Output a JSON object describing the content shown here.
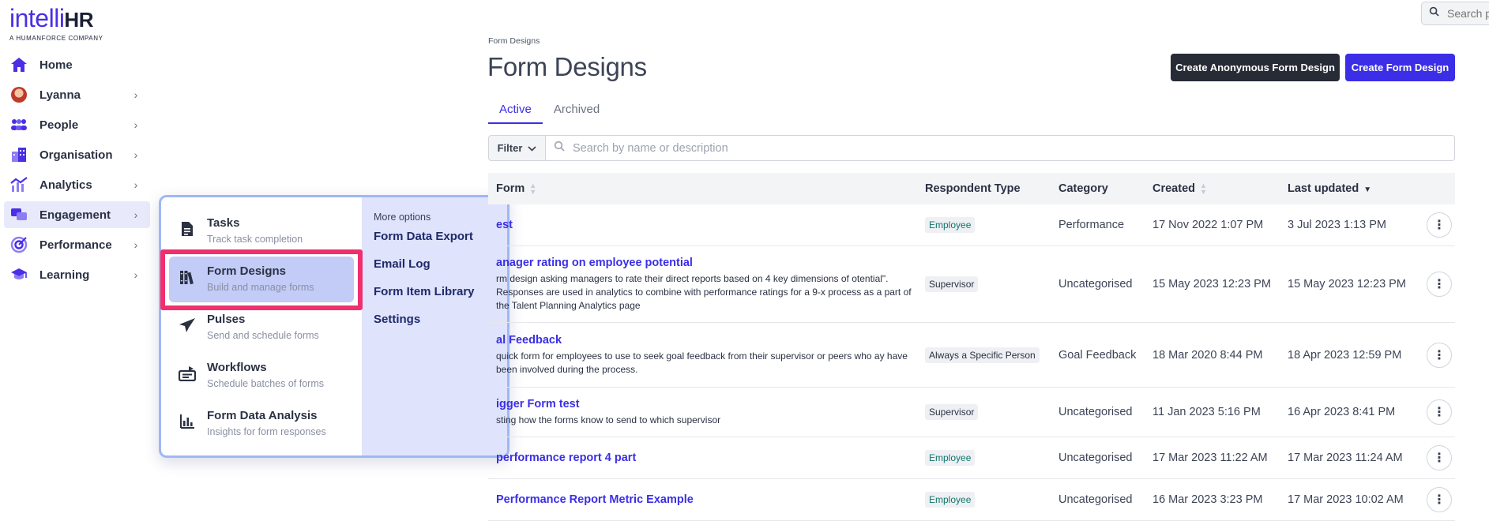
{
  "brand": {
    "name_light": "intelli",
    "name_bold": "HR",
    "tagline": "A HUMANFORCE COMPANY"
  },
  "top_search": {
    "placeholder": "Search pe"
  },
  "sidebar": {
    "items": [
      {
        "label": "Home",
        "icon": "home-icon"
      },
      {
        "label": "Lyanna",
        "icon": "avatar"
      },
      {
        "label": "People",
        "icon": "people-icon"
      },
      {
        "label": "Organisation",
        "icon": "organisation-icon"
      },
      {
        "label": "Analytics",
        "icon": "analytics-icon"
      },
      {
        "label": "Engagement",
        "icon": "engagement-icon",
        "active": true
      },
      {
        "label": "Performance",
        "icon": "performance-icon"
      },
      {
        "label": "Learning",
        "icon": "learning-icon"
      }
    ]
  },
  "flyout": {
    "items": [
      {
        "title": "Tasks",
        "subtitle": "Track task completion",
        "icon": "task-document-icon"
      },
      {
        "title": "Form Designs",
        "subtitle": "Build and manage forms",
        "icon": "form-library-icon",
        "selected": true
      },
      {
        "title": "Pulses",
        "subtitle": "Send and schedule forms",
        "icon": "paper-plane-icon"
      },
      {
        "title": "Workflows",
        "subtitle": "Schedule batches of forms",
        "icon": "workflow-icon"
      },
      {
        "title": "Form Data Analysis",
        "subtitle": "Insights for form responses",
        "icon": "bar-chart-icon"
      }
    ],
    "more_options": {
      "heading": "More options",
      "links": [
        "Form Data Export",
        "Email Log",
        "Form Item Library",
        "Settings"
      ]
    }
  },
  "main": {
    "breadcrumb": "Form Designs",
    "title": "Form Designs",
    "buttons": {
      "anonymous": "Create Anonymous Form Design",
      "create": "Create Form Design"
    },
    "tabs": [
      {
        "label": "Active",
        "active": true
      },
      {
        "label": "Archived"
      }
    ],
    "filter": {
      "label": "Filter",
      "placeholder": "Search by name or description"
    },
    "table": {
      "headers": {
        "form": "Form",
        "respondent": "Respondent Type",
        "category": "Category",
        "created": "Created",
        "updated": "Last updated"
      },
      "rows": [
        {
          "name": "est",
          "description": "",
          "respondent": "Employee",
          "category": "Performance",
          "created": "17 Nov 2022 1:07 PM",
          "updated": "3 Jul 2023 1:13 PM"
        },
        {
          "name": "anager rating on employee potential",
          "description": "rm design asking managers to rate their direct reports based on 4 key dimensions of otential\". Responses are used in analytics to combine with performance ratings for a 9-x process as a part of the Talent Planning Analytics page",
          "respondent": "Supervisor",
          "category": "Uncategorised",
          "created": "15 May 2023 12:23 PM",
          "updated": "15 May 2023 12:23 PM"
        },
        {
          "name": "al Feedback",
          "description": "quick form for employees to use to seek goal feedback from their supervisor or peers who ay have been involved during the process.",
          "respondent": "Always a Specific Person",
          "category": "Goal Feedback",
          "created": "18 Mar 2020 8:44 PM",
          "updated": "18 Apr 2023 12:59 PM"
        },
        {
          "name": "igger Form test",
          "description": "sting how the forms know to send to which supervisor",
          "respondent": "Supervisor",
          "category": "Uncategorised",
          "created": "11 Jan 2023 5:16 PM",
          "updated": "16 Apr 2023 8:41 PM"
        },
        {
          "name": "performance report 4 part",
          "description": "",
          "respondent": "Employee",
          "category": "Uncategorised",
          "created": "17 Mar 2023 11:22 AM",
          "updated": "17 Mar 2023 11:24 AM"
        },
        {
          "name": "Performance Report Metric Example",
          "description": "",
          "respondent": "Employee",
          "category": "Uncategorised",
          "created": "16 Mar 2023 3:23 PM",
          "updated": "17 Mar 2023 10:02 AM"
        }
      ]
    }
  },
  "colors": {
    "accent": "#3b2ee6",
    "highlight": "#f0306e",
    "flyout_panel": "#dfe3fb",
    "dark_button": "#272b36"
  }
}
